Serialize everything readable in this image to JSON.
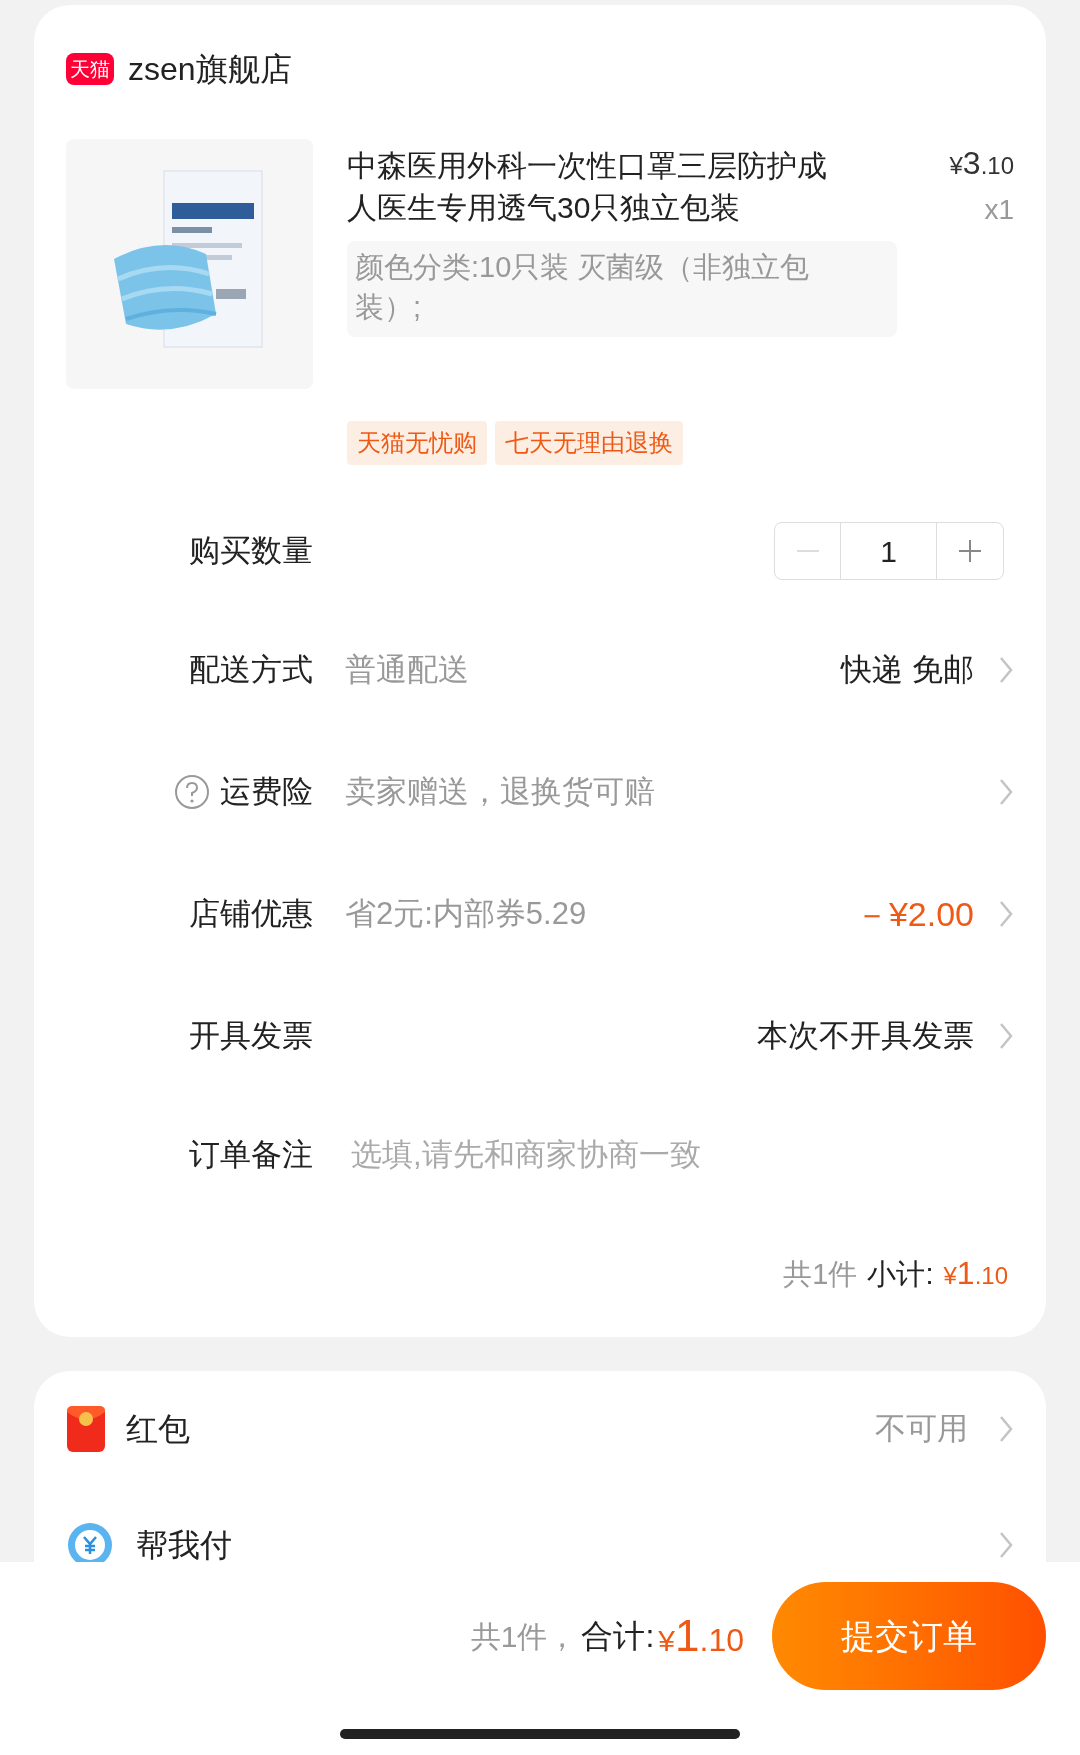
{
  "store": {
    "badge": "天猫",
    "name": "zsen旗舰店"
  },
  "product": {
    "kind": "picture",
    "title": "中森医用外科一次性口罩三层防护成人医生专用透气30只独立包装",
    "price_symbol": "¥",
    "price_int": "3",
    "price_dec": ".10",
    "quantity": "x1",
    "variant": "颜色分类:10只装 灭菌级（非独立包装）;",
    "tags": [
      "天猫无忧购",
      "七天无理由退换"
    ]
  },
  "rows": [
    {
      "kind": "stepper",
      "label": "购买数量",
      "value": "1",
      "minus_disabled": true
    },
    {
      "kind": "option",
      "label": "配送方式",
      "detail": "普通配送",
      "value": "快递 免邮",
      "help": false,
      "highlight": false
    },
    {
      "kind": "option",
      "label": "运费险",
      "detail": "卖家赠送，退换货可赔",
      "help": true
    },
    {
      "kind": "option",
      "label": "店铺优惠",
      "detail": "省2元:内部券5.29",
      "value": "－¥2.00",
      "help": false,
      "highlight": true
    },
    {
      "kind": "option",
      "label": "开具发票",
      "value": "本次不开具发票",
      "help": false,
      "highlight": false
    },
    {
      "kind": "note",
      "label": "订单备注",
      "placeholder": "选填,请先和商家协商一致"
    }
  ],
  "subtotal": {
    "count": "共1件",
    "label": "小计:",
    "symbol": "¥",
    "int": "1",
    "dec": ".10"
  },
  "extras": [
    {
      "kind": "redpacket",
      "label": "红包",
      "value": "不可用"
    },
    {
      "kind": "payforme",
      "label": "帮我付"
    }
  ],
  "footer": {
    "count": "共1件，",
    "label": "合计:",
    "symbol": "¥",
    "int": "1",
    "dec": ".10",
    "submit": "提交订单"
  }
}
